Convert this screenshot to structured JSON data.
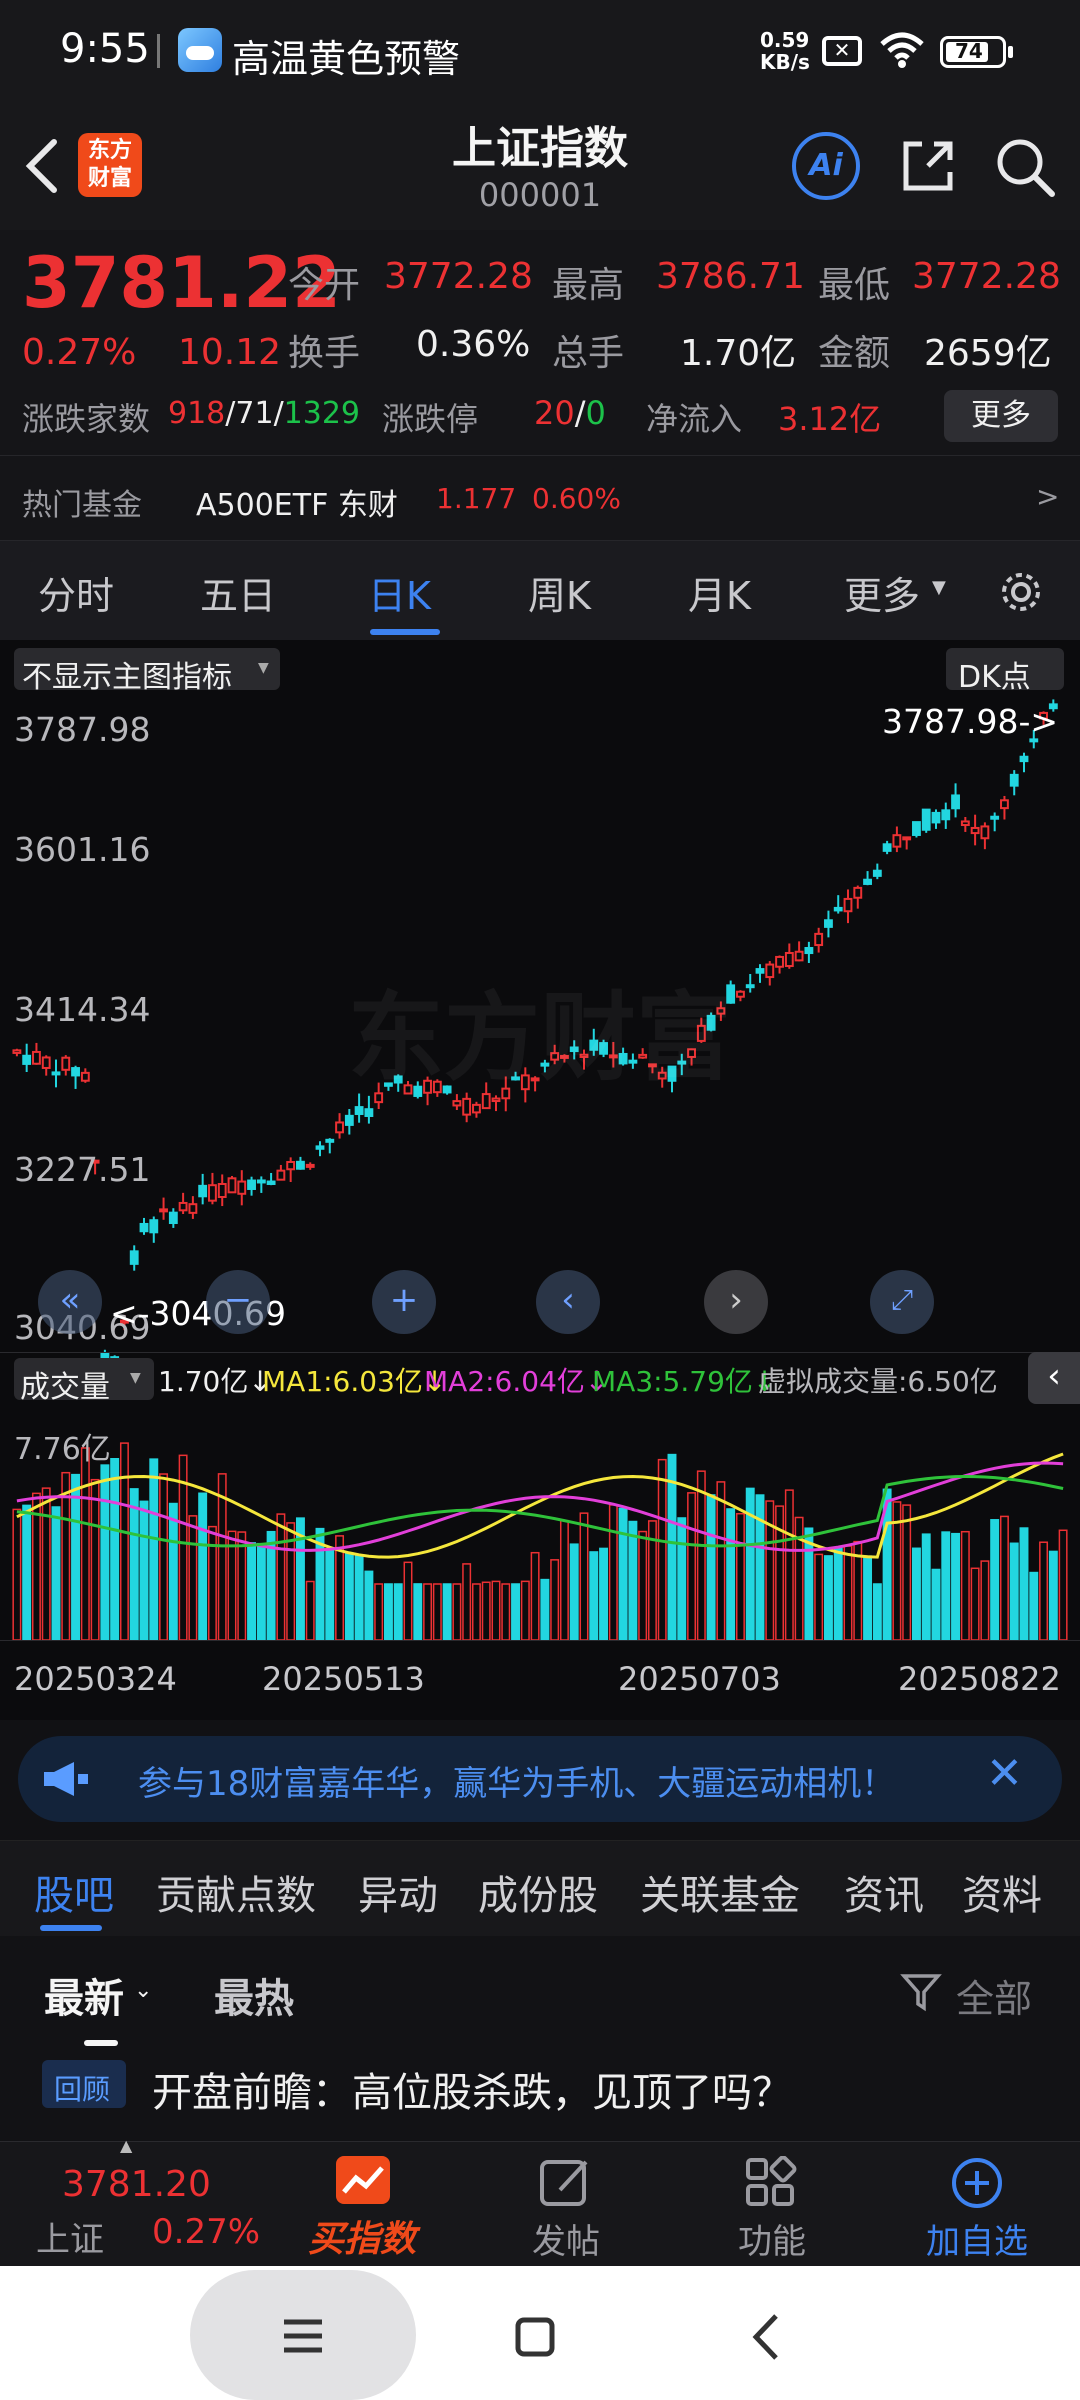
{
  "status": {
    "time": "9:55",
    "notif": "高温黄色预警",
    "net_speed": "0.59",
    "net_unit": "KB/s",
    "battery": "74"
  },
  "header": {
    "logo_text": "东方财富",
    "title": "上证指数",
    "code": "000001",
    "ai_label": "Ai"
  },
  "quote": {
    "price": "3781.22",
    "change_pct": "0.27%",
    "change": "10.12",
    "open_label": "今开",
    "open": "3772.28",
    "high_label": "最高",
    "high": "3786.71",
    "low_label": "最低",
    "low": "3772.28",
    "turnover_label": "换手",
    "turnover": "0.36%",
    "vol_label": "总手",
    "vol": "1.70亿",
    "amount_label": "金额",
    "amount": "2659亿",
    "breadth_label": "涨跌家数",
    "up": "918",
    "flat": "71",
    "down": "1329",
    "sep": "/",
    "limit_label": "涨跌停",
    "limit_up": "20",
    "limit_down": "0",
    "inflow_label": "净流入",
    "inflow": "3.12亿",
    "more_btn": "更多"
  },
  "fund": {
    "label": "热门基金",
    "name": "A500ETF 东财",
    "price": "1.177",
    "pct": "0.60%",
    "arrow": ">"
  },
  "ktabs": [
    "分时",
    "五日",
    "日K",
    "周K",
    "月K",
    "更多"
  ],
  "ktabs_active": 2,
  "chart": {
    "indicator_select": "不显示主图指标",
    "dk_label": "DK点",
    "y_ticks": [
      "3787.98",
      "3601.16",
      "3414.34",
      "3227.51",
      "3040.69"
    ],
    "max_marker": "3787.98->",
    "min_marker": "<-3040.69",
    "watermark": "东方财富",
    "vol_select": "成交量",
    "vol_val": "1.70亿↓",
    "ma1": "MA1:6.03亿↓",
    "ma2": "MA2:6.04亿↓",
    "ma3": "MA3:5.79亿↓",
    "virtual": "虚拟成交量:6.50亿",
    "vol_max": "7.76亿",
    "dates": [
      "20250324",
      "20250513",
      "20250703",
      "20250822"
    ]
  },
  "chart_data": {
    "type": "candlestick",
    "y_range": [
      3040.69,
      3787.98
    ],
    "volume_max": "7.76亿",
    "x_labels": [
      "20250324",
      "20250513",
      "20250703",
      "20250822"
    ],
    "notes": "Daily K-line of 上证指数; min 3040.69, max 3787.98; last volume 1.70亿; MA1 6.03亿, MA2 6.04亿, MA3 5.79亿"
  },
  "banner": {
    "text": "参与18财富嘉年华，赢华为手机、大疆运动相机！"
  },
  "subtabs": [
    "股吧",
    "贡献点数",
    "异动",
    "成份股",
    "关联基金",
    "资讯",
    "资料"
  ],
  "feed": {
    "tab_latest": "最新",
    "tab_hot": "最热",
    "filter": "全部",
    "tag": "回顾",
    "headline": "开盘前瞻：高位股杀跌，见顶了吗？"
  },
  "bottom": {
    "mini_price": "3781.20",
    "mini_name": "上证",
    "mini_pct": "0.27%",
    "buy": "买指数",
    "post": "发帖",
    "func": "功能",
    "add": "加自选"
  },
  "colors": {
    "up": "#ec3133",
    "down": "#1cc24a",
    "accent": "#3d82f0",
    "vol_down": "#22d6e0"
  }
}
